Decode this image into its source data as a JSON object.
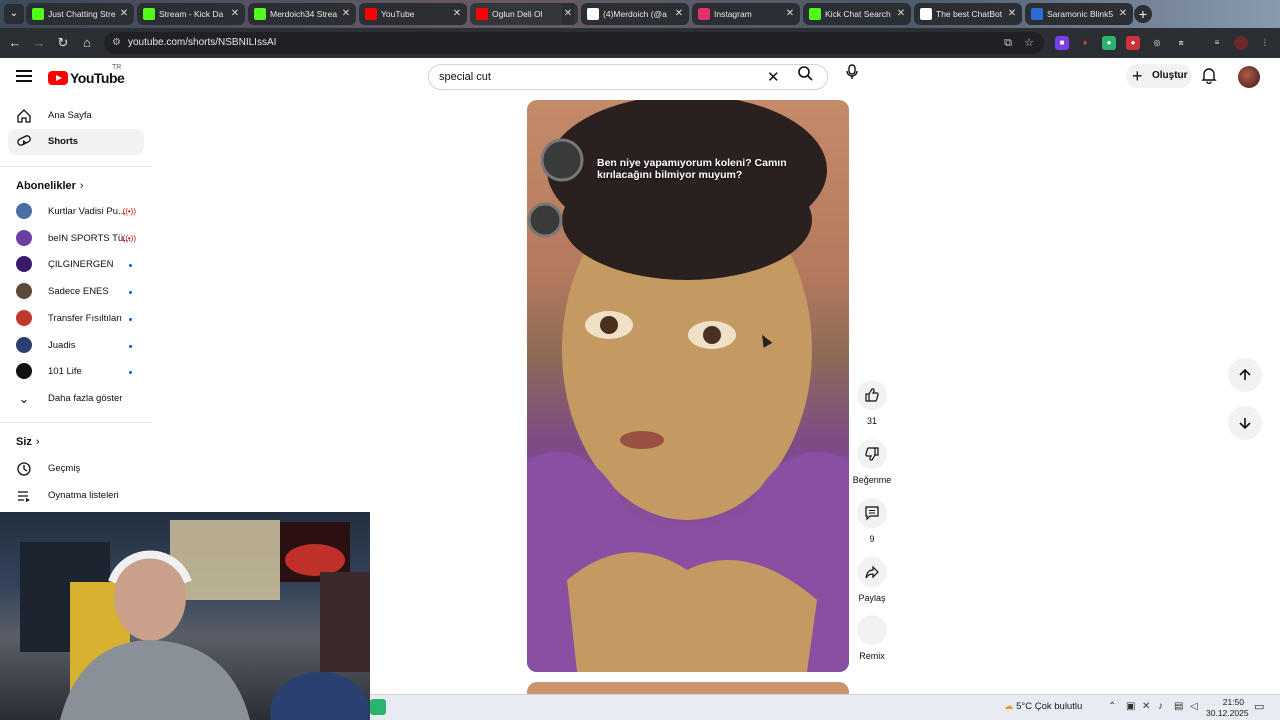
{
  "browser": {
    "tabs": [
      {
        "label": "Just Chatting Stre",
        "icon": "kick-icon",
        "color": "#53fc18"
      },
      {
        "label": "Stream - Kick Da",
        "icon": "kick-icon",
        "color": "#53fc18"
      },
      {
        "label": "Merdoich34 Strea",
        "icon": "kick-icon",
        "color": "#53fc18"
      },
      {
        "label": "YouTube",
        "icon": "youtube-icon",
        "color": "#ff0000"
      },
      {
        "label": "Oglun Deli Ol",
        "icon": "youtube-icon",
        "color": "#ff0000",
        "active": true
      },
      {
        "label": "(4)Merdoich (@a",
        "icon": "tiktok-icon",
        "color": "#ffffff"
      },
      {
        "label": "Instagram",
        "icon": "instagram-icon",
        "color": "#e1306c"
      },
      {
        "label": "Kick Chat Search",
        "icon": "kick-icon",
        "color": "#53fc18"
      },
      {
        "label": "The best ChatBot",
        "icon": "chatbot-icon",
        "color": "#ffffff"
      },
      {
        "label": "Saramonic Blink5",
        "icon": "v-icon",
        "color": "#2b6bd6"
      }
    ],
    "url": "youtube.com/shorts/NSBNILIssAI"
  },
  "header": {
    "logo_text": "YouTube",
    "country_code": "TR",
    "search_value": "special cut",
    "create_label": "Oluştur"
  },
  "sidebar": {
    "main": [
      {
        "label": "Ana Sayfa",
        "icon": "home-icon"
      },
      {
        "label": "Shorts",
        "icon": "shorts-icon",
        "active": true
      }
    ],
    "subs_title": "Abonelikler",
    "subscriptions": [
      {
        "label": "Kurtlar Vadisi Pu...",
        "status": "live",
        "color": "#4a6fa5"
      },
      {
        "label": "beIN SPORTS Tü...",
        "status": "live",
        "color": "#6b3fa0"
      },
      {
        "label": "ÇILGINERGEN",
        "status": "new",
        "color": "#3a1a6a"
      },
      {
        "label": "Sadece ENES",
        "status": "new",
        "color": "#5a4a3a"
      },
      {
        "label": "Transfer Fısıltıları",
        "status": "new",
        "color": "#c0392b"
      },
      {
        "label": "Juadis",
        "status": "new",
        "color": "#2c3e70"
      },
      {
        "label": "101 Life",
        "status": "new",
        "color": "#111111"
      }
    ],
    "show_more": "Daha fazla göster",
    "you_title": "Siz",
    "you_items": [
      {
        "label": "Geçmiş",
        "icon": "history-icon"
      },
      {
        "label": "Oynatma listeleri",
        "icon": "playlist-icon"
      }
    ]
  },
  "short": {
    "caption": "Ben niye yapamıyorum koleni? Camın kırılacağını bilmiyor muyum?"
  },
  "actions": {
    "like_count": "31",
    "dislike_label": "Beğenme",
    "comment_count": "9",
    "share_label": "Paylaş",
    "remix_label": "Remix"
  },
  "taskbar": {
    "weather": "5°C  Çok bulutlu",
    "time": "21:50",
    "date": "30.12.2025"
  }
}
